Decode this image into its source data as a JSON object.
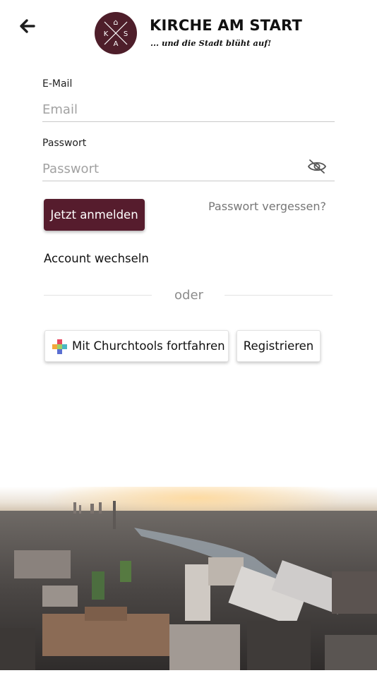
{
  "header": {
    "brand_title": "KIRCHE AM START",
    "brand_subtitle": "... und die Stadt blüht auf!",
    "logo_letters": {
      "top": "⌂",
      "left": "K",
      "right": "S",
      "bottom": "A"
    },
    "logo_color": "#4e1e2a"
  },
  "form": {
    "email_label": "E-Mail",
    "email_placeholder": "Email",
    "password_label": "Passwort",
    "password_placeholder": "Passwort",
    "login_button": "Jetzt anmelden",
    "forgot_password": "Passwort vergessen?",
    "switch_account": "Account wechseln"
  },
  "alt_login": {
    "divider_text": "oder",
    "churchtools_button": "Mit Churchtools fortfahren",
    "register_button": "Registrieren"
  },
  "icons": {
    "back": "arrow-left-icon",
    "visibility": "eye-off-icon",
    "churchtools": "churchtools-logo-icon"
  },
  "colors": {
    "primary": "#561c2d",
    "text": "#222222",
    "muted": "#8c8c8c",
    "input_border": "#c9c9c9"
  }
}
